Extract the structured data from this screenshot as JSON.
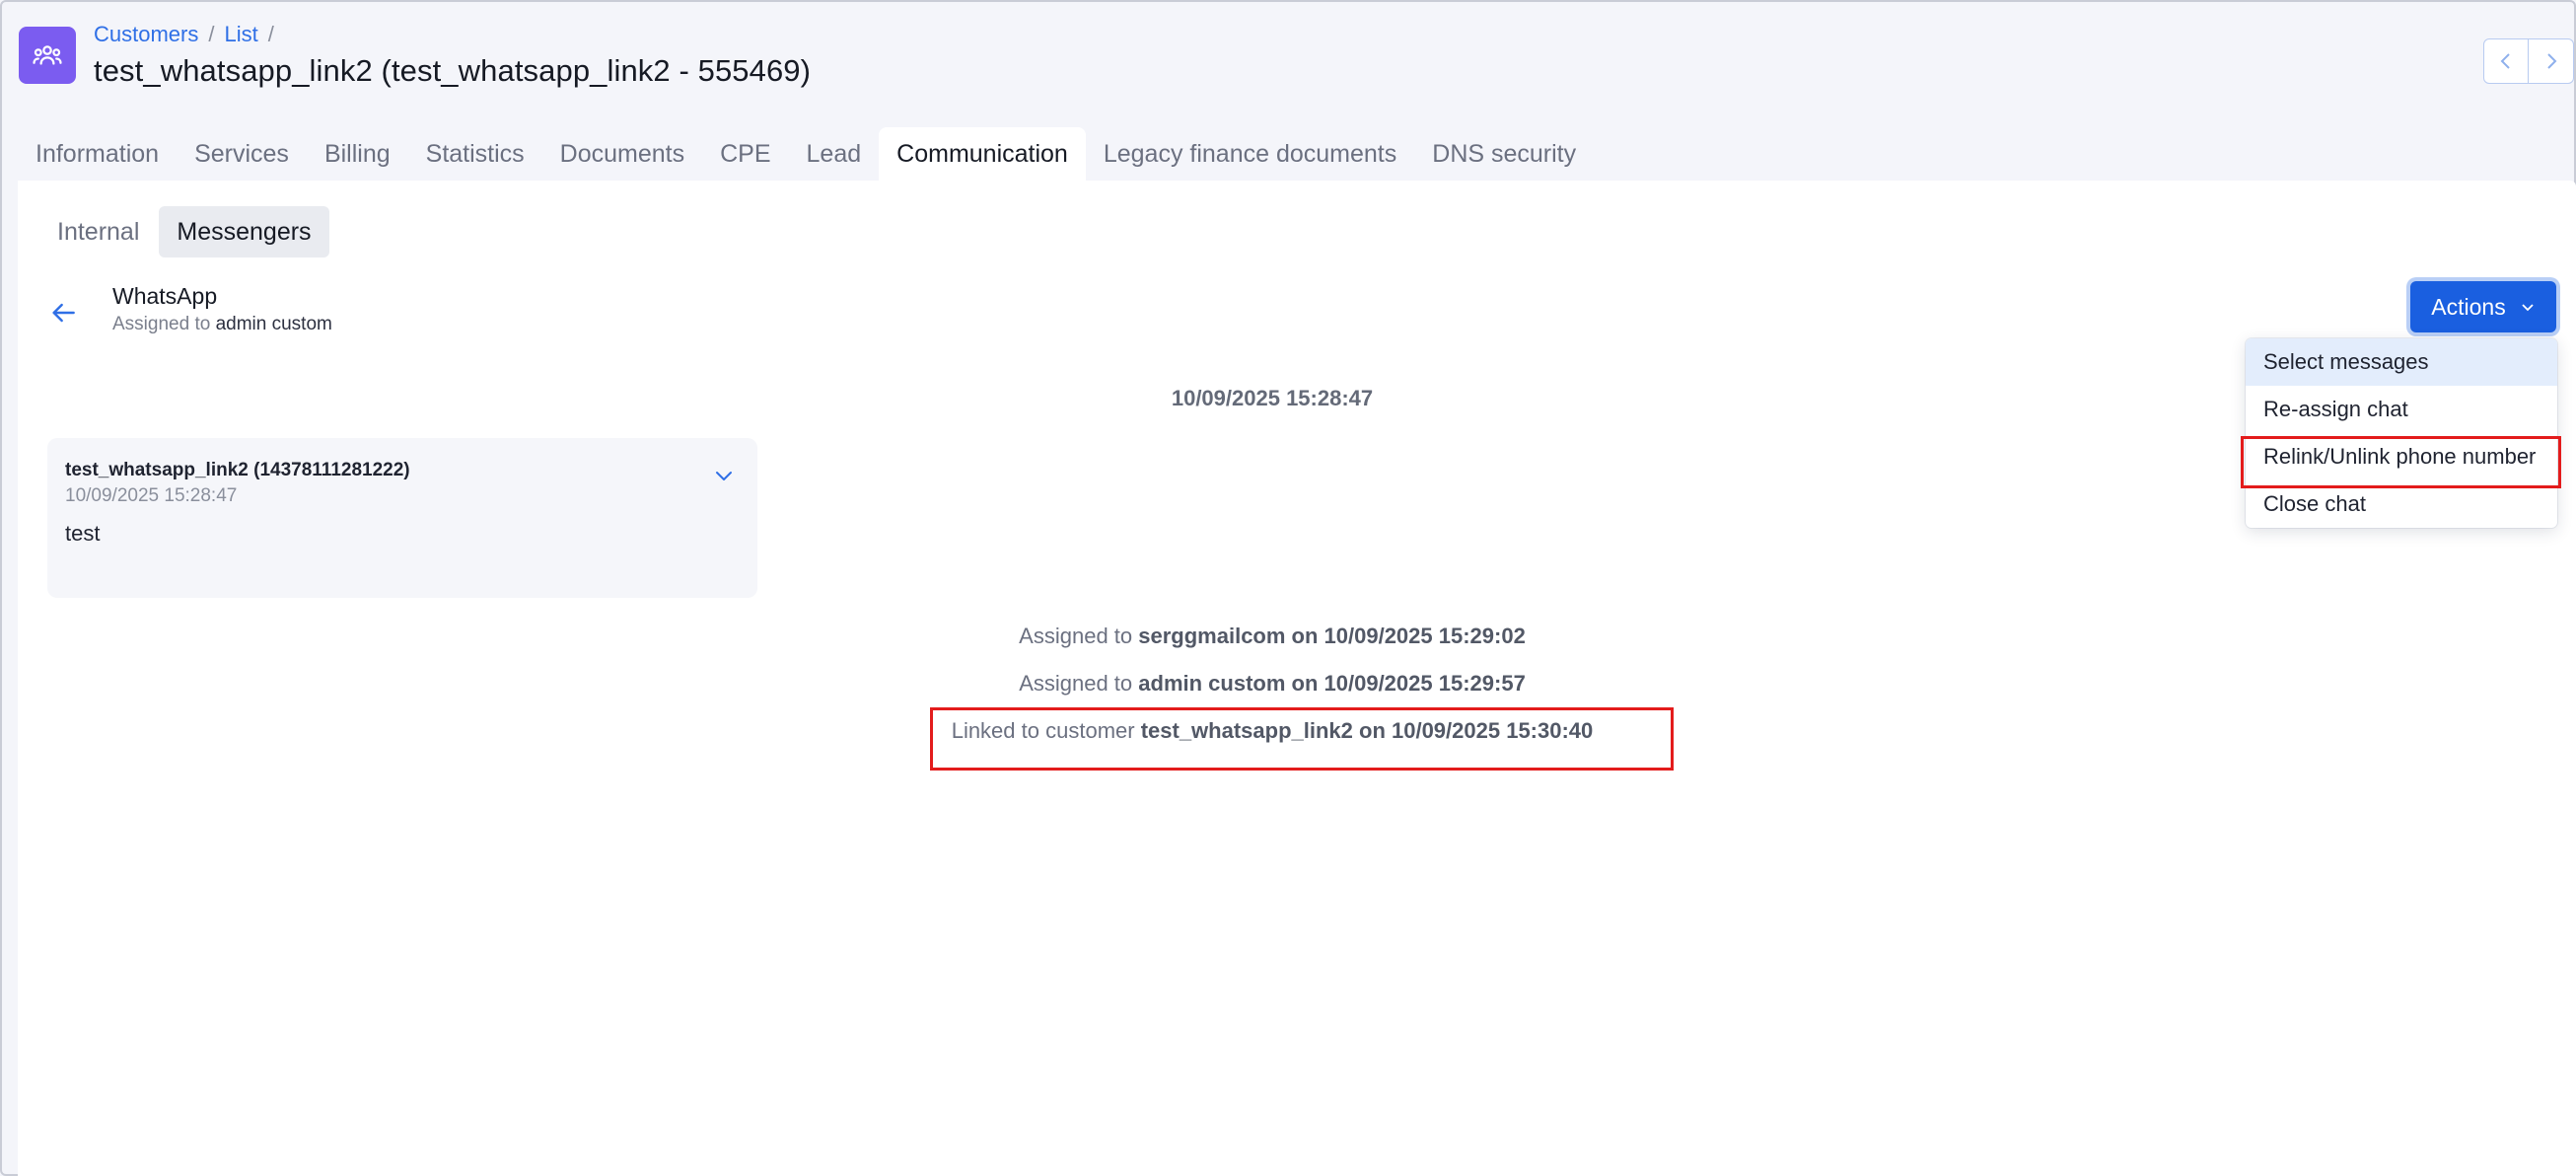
{
  "breadcrumb": {
    "customers": "Customers",
    "sep1": "/",
    "list": "List",
    "sep2": "/"
  },
  "page_title": "test_whatsapp_link2 (test_whatsapp_link2 - 555469)",
  "tabs": [
    {
      "label": "Information"
    },
    {
      "label": "Services"
    },
    {
      "label": "Billing"
    },
    {
      "label": "Statistics"
    },
    {
      "label": "Documents"
    },
    {
      "label": "CPE"
    },
    {
      "label": "Lead"
    },
    {
      "label": "Communication"
    },
    {
      "label": "Legacy finance documents"
    },
    {
      "label": "DNS security"
    }
  ],
  "subtabs": [
    {
      "label": "Internal"
    },
    {
      "label": "Messengers"
    }
  ],
  "chat": {
    "name": "WhatsApp",
    "assigned_prefix": "Assigned to",
    "assigned_to": "admin custom"
  },
  "actions": {
    "label": "Actions",
    "items": [
      {
        "label": "Select messages"
      },
      {
        "label": "Re-assign chat"
      },
      {
        "label": "Relink/Unlink phone number"
      },
      {
        "label": "Close chat"
      }
    ]
  },
  "date_separator": "10/09/2025 15:28:47",
  "message": {
    "author": "test_whatsapp_link2 (14378111281222)",
    "time": "10/09/2025 15:28:47",
    "text": "test"
  },
  "events": [
    {
      "prefix": "Assigned to",
      "detail": "serggmailcom on 10/09/2025 15:29:02"
    },
    {
      "prefix": "Assigned to",
      "detail": "admin custom on 10/09/2025 15:29:57"
    },
    {
      "prefix": "Linked to customer",
      "detail": "test_whatsapp_link2 on 10/09/2025 15:30:40"
    }
  ],
  "colors": {
    "accent": "#1a5fe0",
    "app_icon": "#7b5cf0",
    "highlight": "#e31c1c"
  }
}
